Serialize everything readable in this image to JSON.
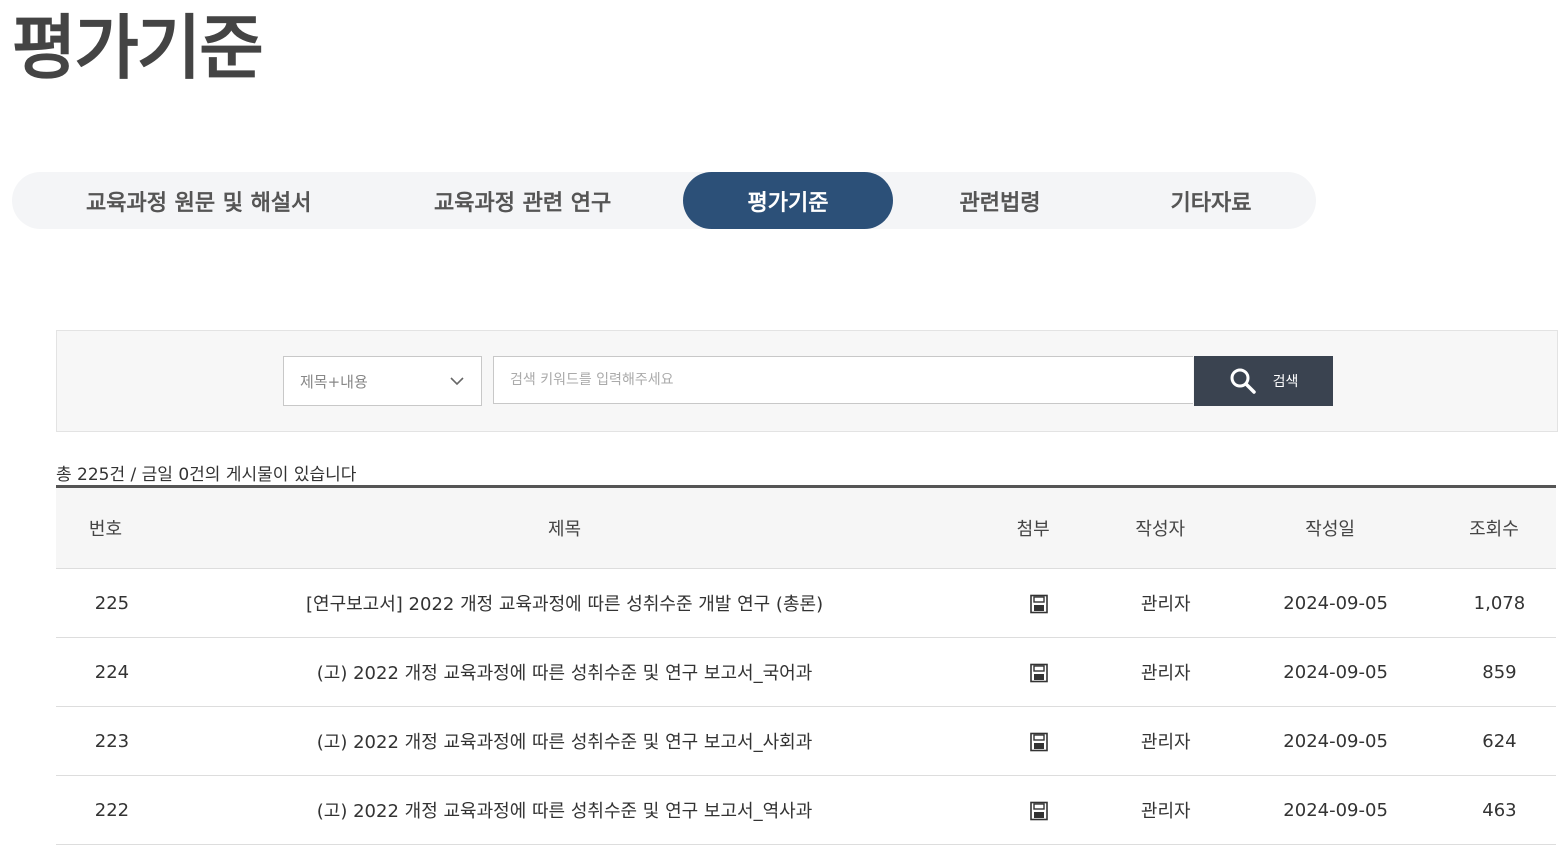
{
  "page": {
    "title": "평가기준"
  },
  "tabs": [
    {
      "label": "교육과정 원문 및 해설서",
      "active": false
    },
    {
      "label": "교육과정 관련 연구",
      "active": false
    },
    {
      "label": "평가기준",
      "active": true
    },
    {
      "label": "관련법령",
      "active": false
    },
    {
      "label": "기타자료",
      "active": false
    }
  ],
  "search": {
    "select_value": "제목+내용",
    "placeholder": "검색 키워드를 입력해주세요",
    "button_label": "검색"
  },
  "summary": "총 225건 / 금일 0건의 게시물이 있습니다",
  "table": {
    "headers": {
      "no": "번호",
      "title": "제목",
      "attach": "첨부",
      "author": "작성자",
      "date": "작성일",
      "views": "조회수"
    },
    "rows": [
      {
        "no": "225",
        "title": "[연구보고서] 2022 개정 교육과정에 따른 성취수준 개발 연구 (총론)",
        "attach": "file-icon",
        "author": "관리자",
        "date": "2024-09-05",
        "views": "1,078"
      },
      {
        "no": "224",
        "title": "(고) 2022 개정 교육과정에 따른 성취수준 및 연구 보고서_국어과",
        "attach": "file-icon",
        "author": "관리자",
        "date": "2024-09-05",
        "views": "859"
      },
      {
        "no": "223",
        "title": "(고) 2022 개정 교육과정에 따른 성취수준 및 연구 보고서_사회과",
        "attach": "file-icon",
        "author": "관리자",
        "date": "2024-09-05",
        "views": "624"
      },
      {
        "no": "222",
        "title": "(고) 2022 개정 교육과정에 따른 성취수준 및 연구 보고서_역사과",
        "attach": "file-icon",
        "author": "관리자",
        "date": "2024-09-05",
        "views": "463"
      }
    ]
  },
  "colors": {
    "accent": "#2c5078",
    "search_button": "#3a4350"
  }
}
